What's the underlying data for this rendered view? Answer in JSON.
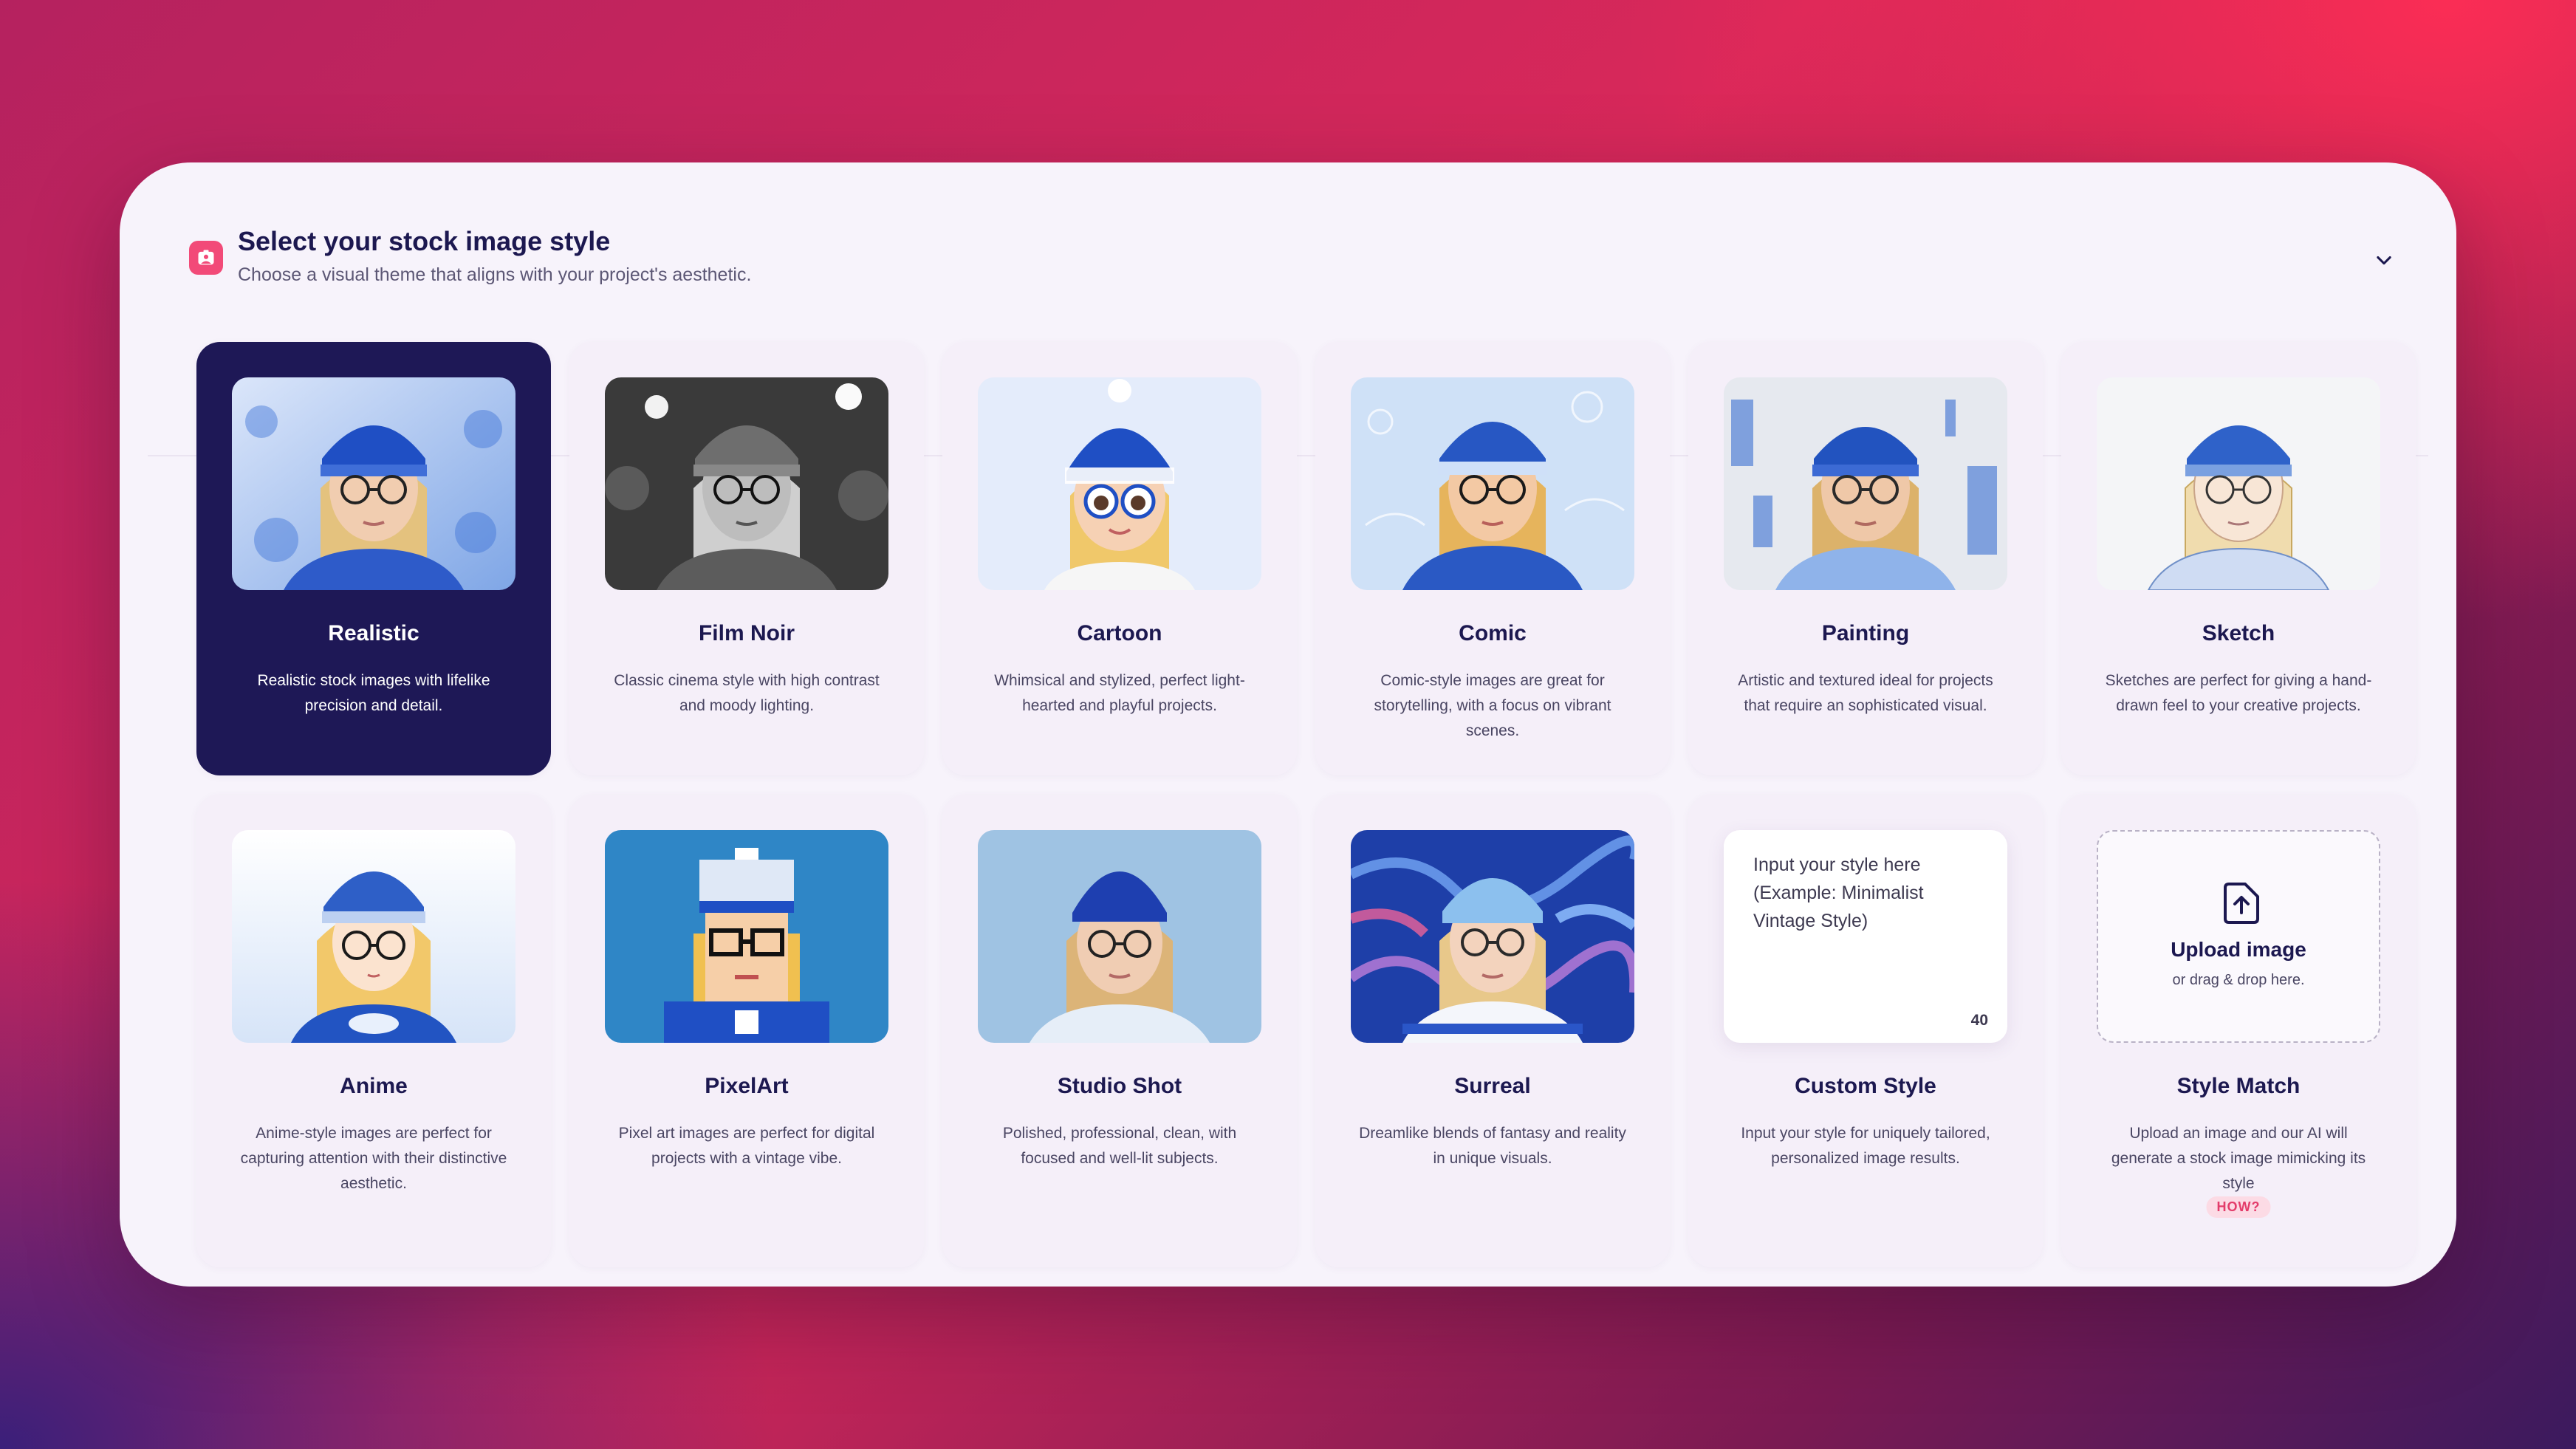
{
  "header": {
    "title": "Select your stock image style",
    "subtitle": "Choose a visual theme that aligns with your project's aesthetic."
  },
  "styles": [
    {
      "title": "Realistic",
      "desc": "Realistic stock images with lifelike precision and detail.",
      "selected": true
    },
    {
      "title": "Film Noir",
      "desc": "Classic cinema style with high contrast and moody lighting."
    },
    {
      "title": "Cartoon",
      "desc": "Whimsical and stylized, perfect light-hearted and playful projects."
    },
    {
      "title": "Comic",
      "desc": "Comic-style images are great for storytelling, with a focus on vibrant scenes."
    },
    {
      "title": "Painting",
      "desc": "Artistic and textured ideal for projects that require an sophisticated visual."
    },
    {
      "title": "Sketch",
      "desc": "Sketches are perfect for giving a hand-drawn feel to your creative projects."
    },
    {
      "title": "Anime",
      "desc": "Anime-style images are perfect for capturing attention with their distinctive aesthetic."
    },
    {
      "title": "PixelArt",
      "desc": "Pixel art images are perfect for digital projects with a vintage vibe."
    },
    {
      "title": "Studio Shot",
      "desc": "Polished, professional, clean, with focused and well-lit subjects."
    },
    {
      "title": "Surreal",
      "desc": "Dreamlike blends of fantasy and reality in unique visuals."
    },
    {
      "title": "Custom Style",
      "desc": "Input your style for uniquely tailored, personalized image results."
    },
    {
      "title": "Style Match",
      "desc": "Upload an image and our AI will generate a stock image mimicking its style"
    }
  ],
  "custom": {
    "placeholder": "Input your style here\n(Example: Minimalist\nVintage Style)",
    "count": "40"
  },
  "upload": {
    "label": "Upload image",
    "hint": "or drag & drop here.",
    "how": "HOW?"
  },
  "colors": {
    "accent": "#f24a78",
    "selected_card": "#1e1856",
    "hat_blue": "#1f4fc4",
    "hair_blonde": "#e8c27a"
  },
  "icons": {
    "header": "image-icon",
    "toggle": "chevron-down-icon",
    "upload": "upload-file-icon"
  }
}
